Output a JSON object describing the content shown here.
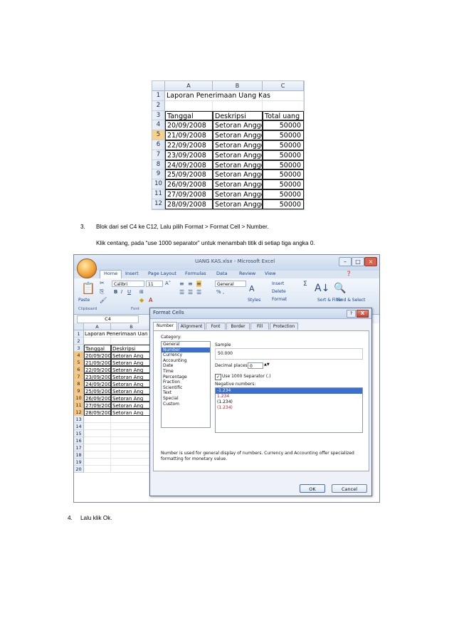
{
  "sheet1": {
    "columns": [
      "A",
      "B",
      "C"
    ],
    "title": "Laporan Penerimaan Uang Kas",
    "headers": [
      "Tanggal",
      "Deskripsi",
      "Total uang"
    ],
    "rows": [
      [
        "20/09/2008",
        "Setoran Anggota",
        "50000"
      ],
      [
        "21/09/2008",
        "Setoran Anggota",
        "50000"
      ],
      [
        "22/09/2008",
        "Setoran Anggota",
        "50000"
      ],
      [
        "23/09/2008",
        "Setoran Anggota",
        "50000"
      ],
      [
        "24/09/2008",
        "Setoran Anggota",
        "50000"
      ],
      [
        "25/09/2008",
        "Setoran Anggota",
        "50000"
      ],
      [
        "26/09/2008",
        "Setoran Anggota",
        "50000"
      ],
      [
        "27/09/2008",
        "Setoran Anggota",
        "50000"
      ],
      [
        "28/09/2008",
        "Setoran Anggota",
        "50000"
      ]
    ],
    "row_numbers": [
      "1",
      "2",
      "3",
      "4",
      "5",
      "6",
      "7",
      "8",
      "9",
      "10",
      "11",
      "12"
    ]
  },
  "step3": {
    "number": "3.",
    "text": "Blok dari sel C4 ke C12, Lalu pilih Format > Format Cell > Number.",
    "subtext": "Klik centang, pada “use 1000 separator” untuk menambah titik di setiap tiga angka 0."
  },
  "step4": {
    "number": "4.",
    "text": "Lalu klik Ok."
  },
  "excel": {
    "window_title": "UANG KAS.xlsx - Microsoft Excel",
    "tabs": [
      "Home",
      "Insert",
      "Page Layout",
      "Formulas",
      "Data",
      "Review",
      "View"
    ],
    "font_name": "Calibri",
    "font_size": "11",
    "number_format": "General",
    "ribbon": {
      "paste": "Paste",
      "clipboard": "Clipboard",
      "font_group": "Font",
      "styles": "Styles",
      "insert": "Insert",
      "delete": "Delete",
      "format": "Format",
      "sort": "Sort & Filter",
      "find": "Find & Select"
    },
    "name_box": "C4",
    "grid_columns": [
      "A",
      "B"
    ],
    "grid_row_numbers": [
      "1",
      "2",
      "3",
      "4",
      "5",
      "6",
      "7",
      "8",
      "9",
      "10",
      "11",
      "12",
      "13",
      "14",
      "15",
      "16",
      "17",
      "18",
      "19",
      "20"
    ],
    "grid_title": "Laporan Penerimaan Uan",
    "grid_headers": [
      "Tanggal",
      "Deskripsi"
    ],
    "grid_dates": [
      "20/09/2008",
      "21/09/2008",
      "22/09/2008",
      "23/09/2008",
      "24/09/2008",
      "25/09/2008",
      "26/09/2008",
      "27/09/2008",
      "28/09/2008"
    ],
    "grid_desc": "Setoran Ang"
  },
  "dialog": {
    "title": "Format Cells",
    "tabs": [
      "Number",
      "Alignment",
      "Font",
      "Border",
      "Fill",
      "Protection"
    ],
    "category_label": "Category:",
    "categories": [
      "General",
      "Number",
      "Currency",
      "Accounting",
      "Date",
      "Time",
      "Percentage",
      "Fraction",
      "Scientific",
      "Text",
      "Special",
      "Custom"
    ],
    "selected_category": "Number",
    "sample_label": "Sample",
    "sample_value": "50.000",
    "decimal_label": "Decimal places:",
    "decimal_value": "0",
    "separator_label": "Use 1000 Separator (.)",
    "separator_checked": true,
    "negative_label": "Negative numbers:",
    "negative_options": [
      "-1.234",
      "1.234",
      "(1.234)",
      "(1.234)"
    ],
    "description": "Number is used for general display of numbers. Currency and Accounting offer specialized formatting for monetary value.",
    "ok": "OK",
    "cancel": "Cancel",
    "help": "?",
    "close": "X"
  }
}
